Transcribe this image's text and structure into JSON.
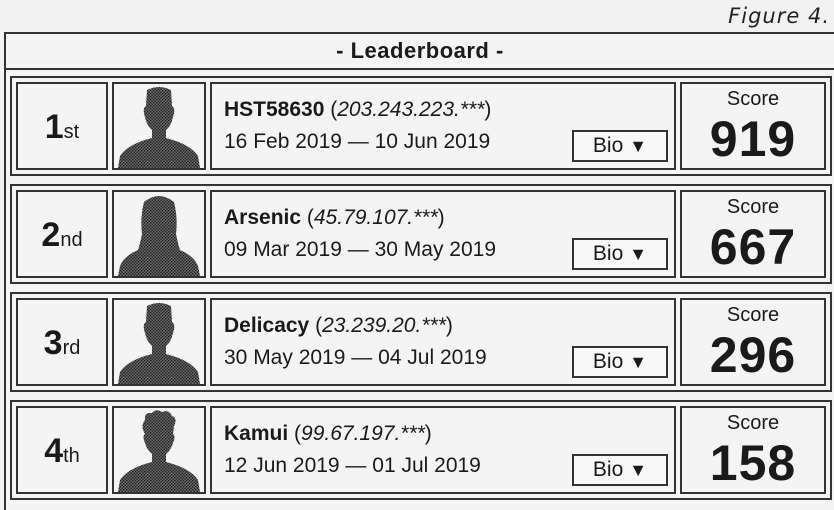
{
  "figure_label": "Figure 4.",
  "header": {
    "title": "- Leaderboard -"
  },
  "entries": [
    {
      "rank_number": "1",
      "rank_suffix": "st",
      "avatar": "male-silhouette-icon",
      "name": "HST58630",
      "ip": "203.243.223.***",
      "dates": "16 Feb 2019 — 10 Jun 2019",
      "bio_label": "Bio",
      "bio_caret": "▼",
      "score_label": "Score",
      "score": "919"
    },
    {
      "rank_number": "2",
      "rank_suffix": "nd",
      "avatar": "female-silhouette-icon",
      "name": "Arsenic",
      "ip": "45.79.107.***",
      "dates": "09 Mar 2019 — 30 May 2019",
      "bio_label": "Bio",
      "bio_caret": "▼",
      "score_label": "Score",
      "score": "667"
    },
    {
      "rank_number": "3",
      "rank_suffix": "rd",
      "avatar": "male-silhouette-icon",
      "name": "Delicacy",
      "ip": "23.239.20.***",
      "dates": "30 May 2019 — 04 Jul 2019",
      "bio_label": "Bio",
      "bio_caret": "▼",
      "score_label": "Score",
      "score": "296"
    },
    {
      "rank_number": "4",
      "rank_suffix": "th",
      "avatar": "curly-hair-silhouette-icon",
      "name": "Kamui",
      "ip": "99.67.197.***",
      "dates": "12 Jun 2019 — 01 Jul 2019",
      "bio_label": "Bio",
      "bio_caret": "▼",
      "score_label": "Score",
      "score": "158"
    }
  ]
}
